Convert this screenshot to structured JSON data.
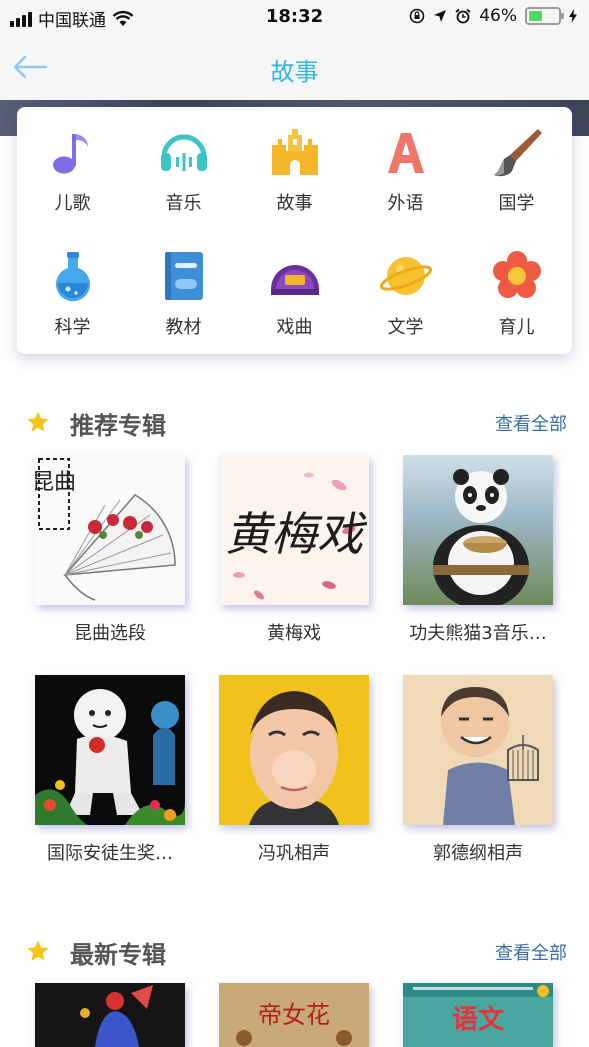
{
  "status_bar": {
    "carrier": "中国联通",
    "time": "18:32",
    "battery_percent": "46%",
    "battery_level": 0.46,
    "icons": [
      "signal-icon",
      "wifi-icon",
      "rotation-lock-icon",
      "location-icon",
      "alarm-icon",
      "charging-icon"
    ]
  },
  "nav": {
    "title": "故事",
    "back_icon": "back-arrow-icon"
  },
  "categories": [
    {
      "label": "儿歌",
      "icon": "music-note-icon"
    },
    {
      "label": "音乐",
      "icon": "headphones-icon"
    },
    {
      "label": "故事",
      "icon": "castle-icon"
    },
    {
      "label": "外语",
      "icon": "letter-a-icon"
    },
    {
      "label": "国学",
      "icon": "brush-icon"
    },
    {
      "label": "科学",
      "icon": "flask-icon"
    },
    {
      "label": "教材",
      "icon": "book-icon"
    },
    {
      "label": "戏曲",
      "icon": "opera-hat-icon"
    },
    {
      "label": "文学",
      "icon": "planet-icon"
    },
    {
      "label": "育儿",
      "icon": "flower-icon"
    }
  ],
  "recommended": {
    "title": "推荐专辑",
    "view_all": "查看全部",
    "albums": [
      {
        "name": "昆曲选段",
        "cover_text": "昆曲"
      },
      {
        "name": "黄梅戏",
        "cover_text": "黄梅戏"
      },
      {
        "name": "功夫熊猫3音乐…"
      },
      {
        "name": "国际安徒生奖…"
      },
      {
        "name": "冯巩相声"
      },
      {
        "name": "郭德纲相声"
      }
    ]
  },
  "latest": {
    "title": "最新专辑",
    "view_all": "查看全部",
    "albums": [
      {
        "name": ""
      },
      {
        "name": "",
        "cover_text": "帝女花"
      },
      {
        "name": "",
        "cover_text": "语文"
      }
    ]
  },
  "colors": {
    "accent": "#33b5e5",
    "link": "#3a6ea5",
    "star": "#f5c518"
  }
}
